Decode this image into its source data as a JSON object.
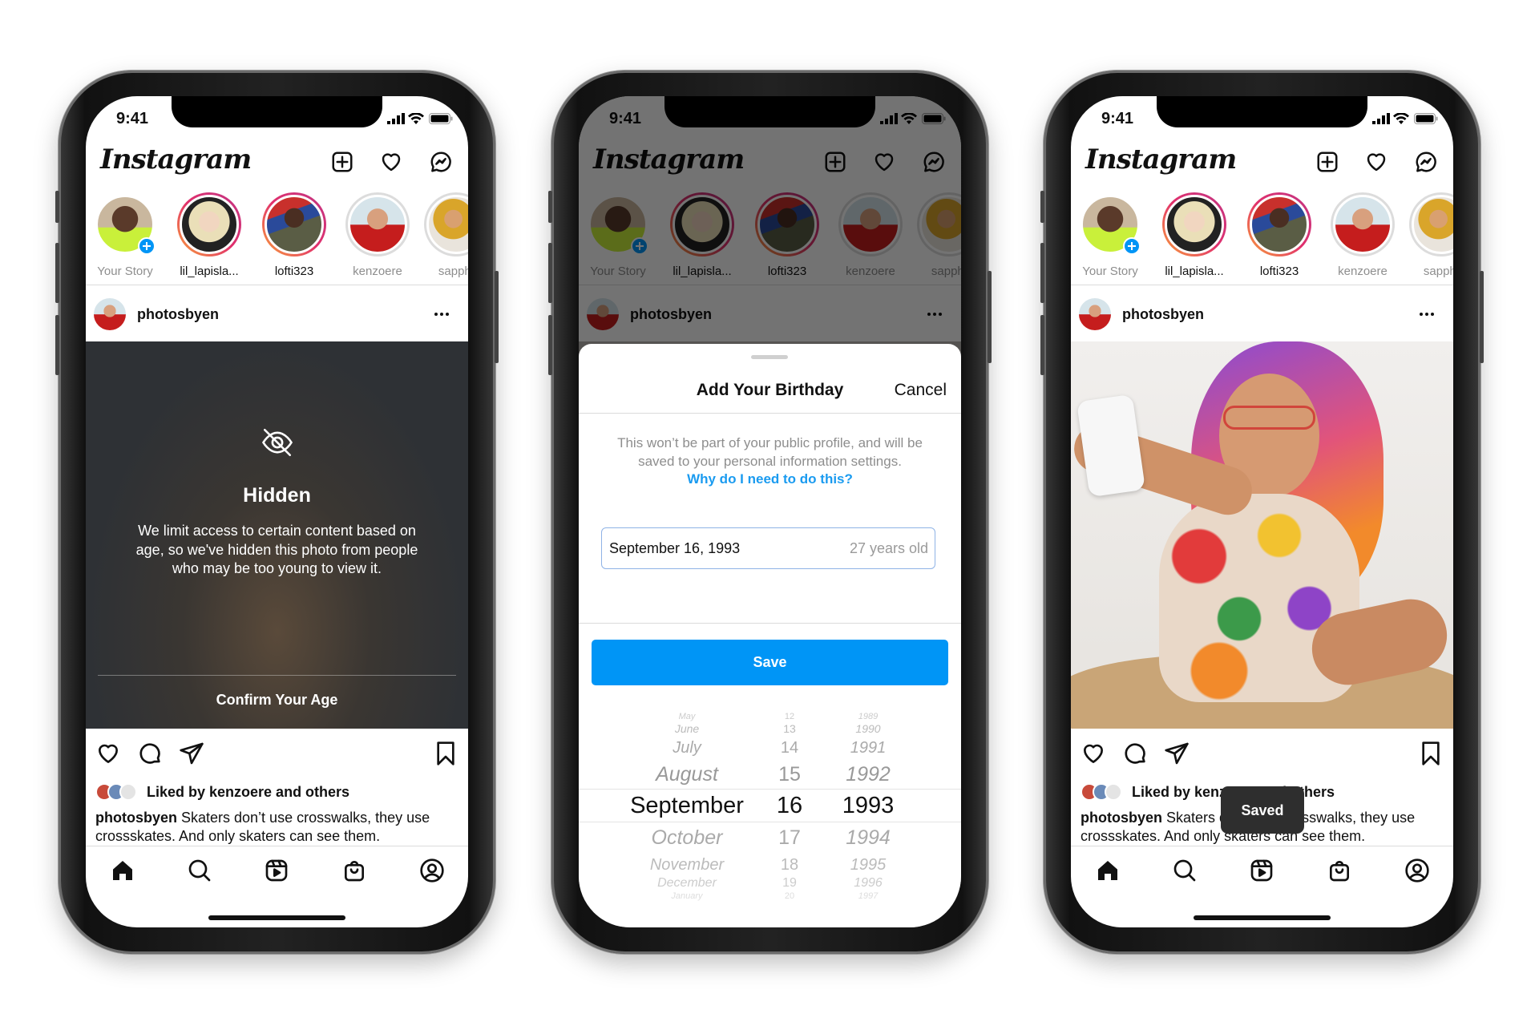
{
  "status": {
    "time": "9:41",
    "icons": [
      "signal-icon",
      "wifi-icon",
      "battery-icon"
    ]
  },
  "feed": {
    "app_name": "Instagram",
    "header_icons": [
      "new-post-icon",
      "heart-icon",
      "messenger-icon"
    ],
    "stories": [
      {
        "name": "Your Story",
        "ring": "none",
        "own": true
      },
      {
        "name": "lil_lapisla...",
        "ring": "unseen"
      },
      {
        "name": "lofti323",
        "ring": "unseen"
      },
      {
        "name": "kenzoere",
        "ring": "seen"
      },
      {
        "name": "sapphi",
        "ring": "seen"
      }
    ],
    "post": {
      "username": "photosbyen",
      "more_icon": "more-icon",
      "action_icons": [
        "like-icon",
        "comment-icon",
        "share-icon",
        "bookmark-icon"
      ],
      "liked_by": "Liked by kenzoere and others",
      "caption_user": "photosbyen",
      "caption_text": " Skaters don’t use crosswalks, they use crossskates. And only skaters can see them."
    },
    "tab_icons": [
      "home-icon",
      "search-icon",
      "reels-icon",
      "shop-icon",
      "profile-icon"
    ]
  },
  "phones": [
    {
      "state": "hidden",
      "hidden": {
        "icon": "eye-off-icon",
        "title": "Hidden",
        "body": "We limit access to certain content based on age, so we've hidden this photo from people who may be too young to view it.",
        "action": "Confirm Your Age"
      }
    },
    {
      "state": "birthday-sheet",
      "sheet": {
        "title": "Add Your Birthday",
        "cancel": "Cancel",
        "description": "This won’t be part of your public profile, and will be saved to your personal information settings.",
        "link": "Why do I need to do this?",
        "date_value": "September 16, 1993",
        "age": "27 years old",
        "save": "Save",
        "picker": {
          "months": [
            "May",
            "June",
            "July",
            "August",
            "September",
            "October",
            "November",
            "December",
            "January"
          ],
          "days": [
            "12",
            "13",
            "14",
            "15",
            "16",
            "17",
            "18",
            "19",
            "20"
          ],
          "years": [
            "1989",
            "1990",
            "1991",
            "1992",
            "1993",
            "1994",
            "1995",
            "1996",
            "1997"
          ],
          "selected": {
            "month": "September",
            "day": "16",
            "year": "1993"
          }
        }
      }
    },
    {
      "state": "photo",
      "toast": "Saved"
    }
  ],
  "colors": {
    "accent": "#0095f6",
    "link": "#1a9bf0",
    "toast": "#2e2e2e"
  }
}
